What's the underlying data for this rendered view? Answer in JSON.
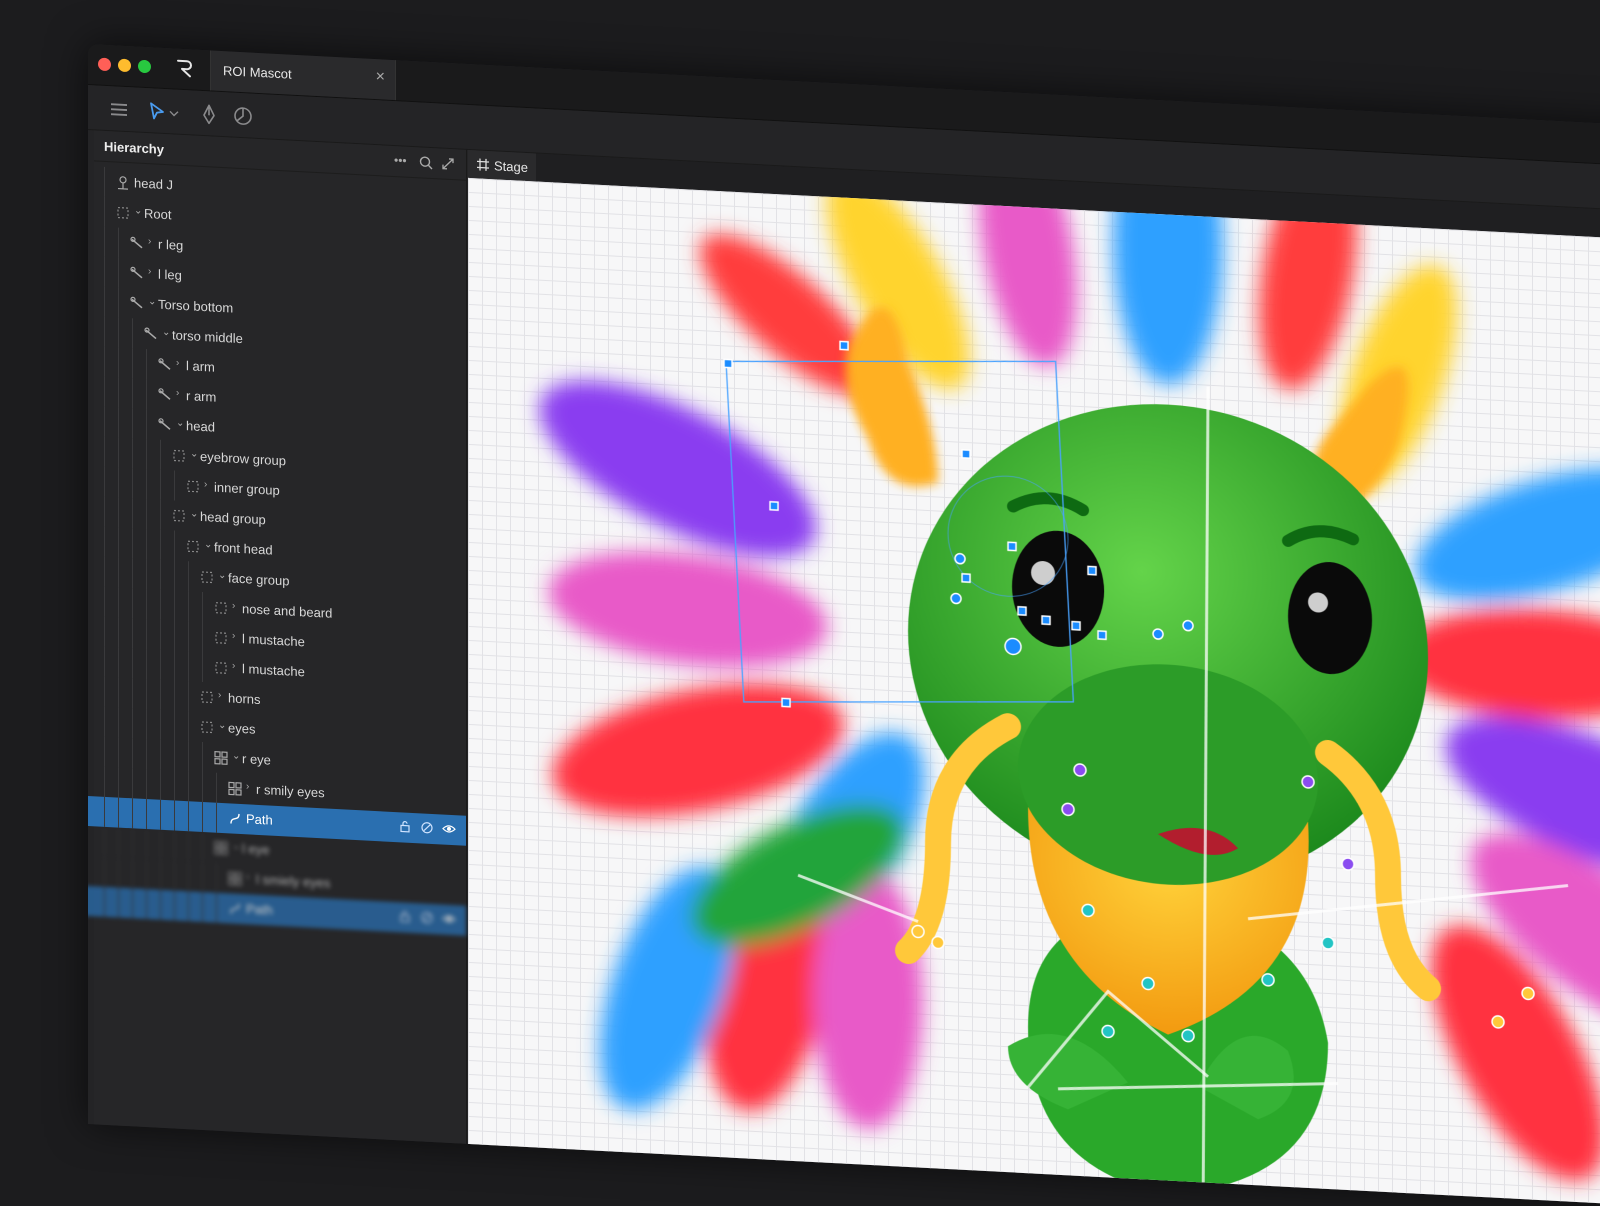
{
  "window": {
    "document_title": "ROI Mascot"
  },
  "hierarchy": {
    "title": "Hierarchy",
    "rows": [
      {
        "label": "head J",
        "depth": 0,
        "icon": "bone-root-icon",
        "chevron": ""
      },
      {
        "label": "Root",
        "depth": 0,
        "icon": "group-icon",
        "chevron": "⌄"
      },
      {
        "label": "r leg",
        "depth": 1,
        "icon": "bone-icon",
        "chevron": "›"
      },
      {
        "label": "l leg",
        "depth": 1,
        "icon": "bone-icon",
        "chevron": "›"
      },
      {
        "label": "Torso bottom",
        "depth": 1,
        "icon": "bone-icon",
        "chevron": "⌄"
      },
      {
        "label": "torso middle",
        "depth": 2,
        "icon": "bone-icon",
        "chevron": "⌄"
      },
      {
        "label": "l arm",
        "depth": 3,
        "icon": "bone-icon",
        "chevron": "›"
      },
      {
        "label": "r arm",
        "depth": 3,
        "icon": "bone-icon",
        "chevron": "›"
      },
      {
        "label": "head",
        "depth": 3,
        "icon": "bone-icon",
        "chevron": "⌄"
      },
      {
        "label": "eyebrow group",
        "depth": 4,
        "icon": "group-icon",
        "chevron": "⌄"
      },
      {
        "label": "inner group",
        "depth": 5,
        "icon": "group-icon",
        "chevron": "›"
      },
      {
        "label": "head group",
        "depth": 4,
        "icon": "group-icon",
        "chevron": "⌄"
      },
      {
        "label": "front head",
        "depth": 5,
        "icon": "group-icon",
        "chevron": "⌄"
      },
      {
        "label": "face group",
        "depth": 6,
        "icon": "group-icon",
        "chevron": "⌄"
      },
      {
        "label": "nose and beard",
        "depth": 7,
        "icon": "group-icon",
        "chevron": "›"
      },
      {
        "label": "l mustache",
        "depth": 7,
        "icon": "group-icon",
        "chevron": "›"
      },
      {
        "label": "l mustache",
        "depth": 7,
        "icon": "group-icon",
        "chevron": "›"
      },
      {
        "label": "horns",
        "depth": 6,
        "icon": "group-icon",
        "chevron": "›"
      },
      {
        "label": "eyes",
        "depth": 6,
        "icon": "group-icon",
        "chevron": "⌄"
      },
      {
        "label": "r eye",
        "depth": 7,
        "icon": "shape-icon",
        "chevron": "⌄"
      },
      {
        "label": "r smily eyes",
        "depth": 8,
        "icon": "shape-icon",
        "chevron": "›"
      },
      {
        "label": "Path",
        "depth": 8,
        "icon": "path-icon",
        "chevron": "",
        "selected": true
      },
      {
        "label": "l eye",
        "depth": 7,
        "icon": "shape-icon",
        "chevron": "⌄",
        "blurred": true
      },
      {
        "label": "l smiely eyes",
        "depth": 8,
        "icon": "shape-icon",
        "chevron": "›",
        "blurred": true
      },
      {
        "label": "Path",
        "depth": 8,
        "icon": "path-icon",
        "chevron": "",
        "selected": true,
        "blurred": true
      }
    ]
  },
  "stage": {
    "tab_label": "Stage"
  },
  "colors": {
    "accent": "#2a6fb0",
    "selection": "#2a6fb0"
  }
}
